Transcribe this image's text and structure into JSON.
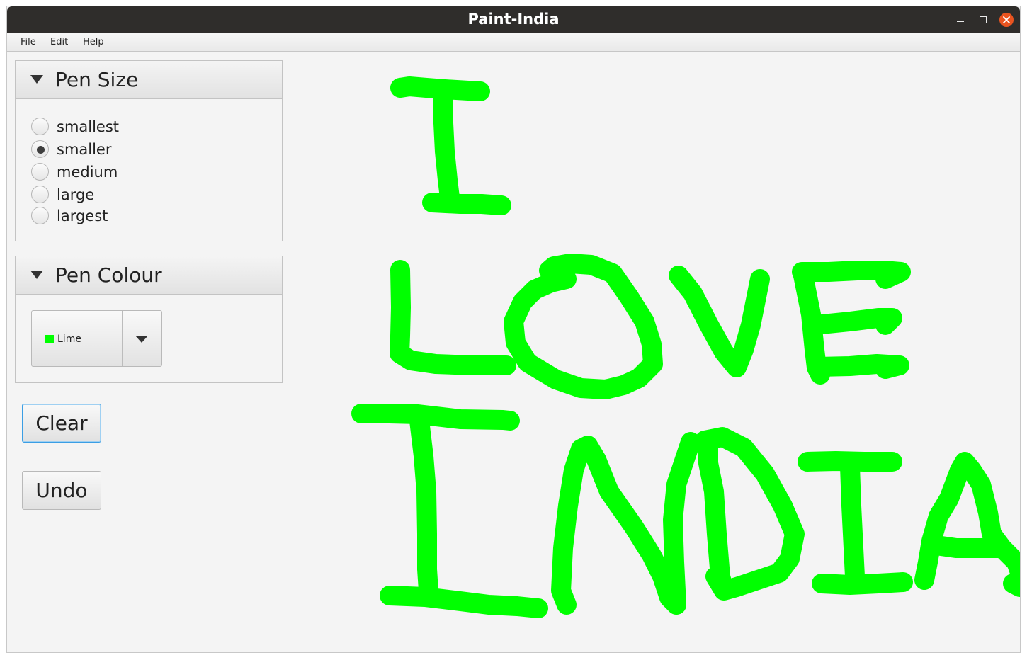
{
  "window": {
    "title": "Paint-India"
  },
  "menu": {
    "items": [
      "File",
      "Edit",
      "Help"
    ]
  },
  "pen_size": {
    "title": "Pen Size",
    "options": [
      "smallest",
      "smaller",
      "medium",
      "large",
      "largest"
    ],
    "selected": "smaller"
  },
  "pen_colour": {
    "title": "Pen Colour",
    "selected_label": "Lime",
    "selected_color": "#00ff00"
  },
  "buttons": {
    "clear": "Clear",
    "undo": "Undo"
  },
  "canvas": {
    "stroke_color": "#00ff00"
  }
}
